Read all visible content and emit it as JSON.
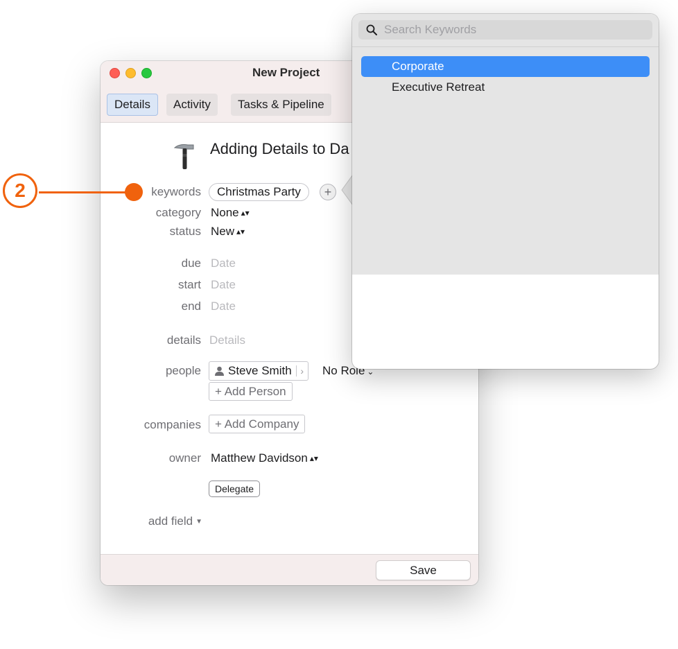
{
  "window": {
    "title": "New Project",
    "tabs": [
      {
        "label": "Details"
      },
      {
        "label": "Activity"
      },
      {
        "label": "Tasks & Pipeline"
      }
    ],
    "heading": "Adding Details to Da"
  },
  "form": {
    "keywords_label": "keywords",
    "keyword_chip": "Christmas Party",
    "add_keyword_symbol": "+",
    "category_label": "category",
    "category_value": "None",
    "status_label": "status",
    "status_value": "New",
    "due_label": "due",
    "due_placeholder": "Date",
    "start_label": "start",
    "start_placeholder": "Date",
    "end_label": "end",
    "end_placeholder": "Date",
    "details_label": "details",
    "details_placeholder": "Details",
    "people_label": "people",
    "person_name": "Steve Smith",
    "person_role": "No Role",
    "add_person": "+ Add Person",
    "companies_label": "companies",
    "add_company": "+ Add Company",
    "owner_label": "owner",
    "owner_value": "Matthew Davidson",
    "delegate_button": "Delegate",
    "add_field": "add field"
  },
  "footer": {
    "save_label": "Save"
  },
  "popover": {
    "search_placeholder": "Search Keywords",
    "items": [
      {
        "label": "Corporate",
        "selected": true
      },
      {
        "label": "Executive Retreat",
        "selected": false
      }
    ]
  },
  "annotation": {
    "step_number": "2",
    "color": "#f0620d"
  },
  "colors": {
    "selection": "#3d8ef7",
    "titlebar": "#f5eded"
  }
}
